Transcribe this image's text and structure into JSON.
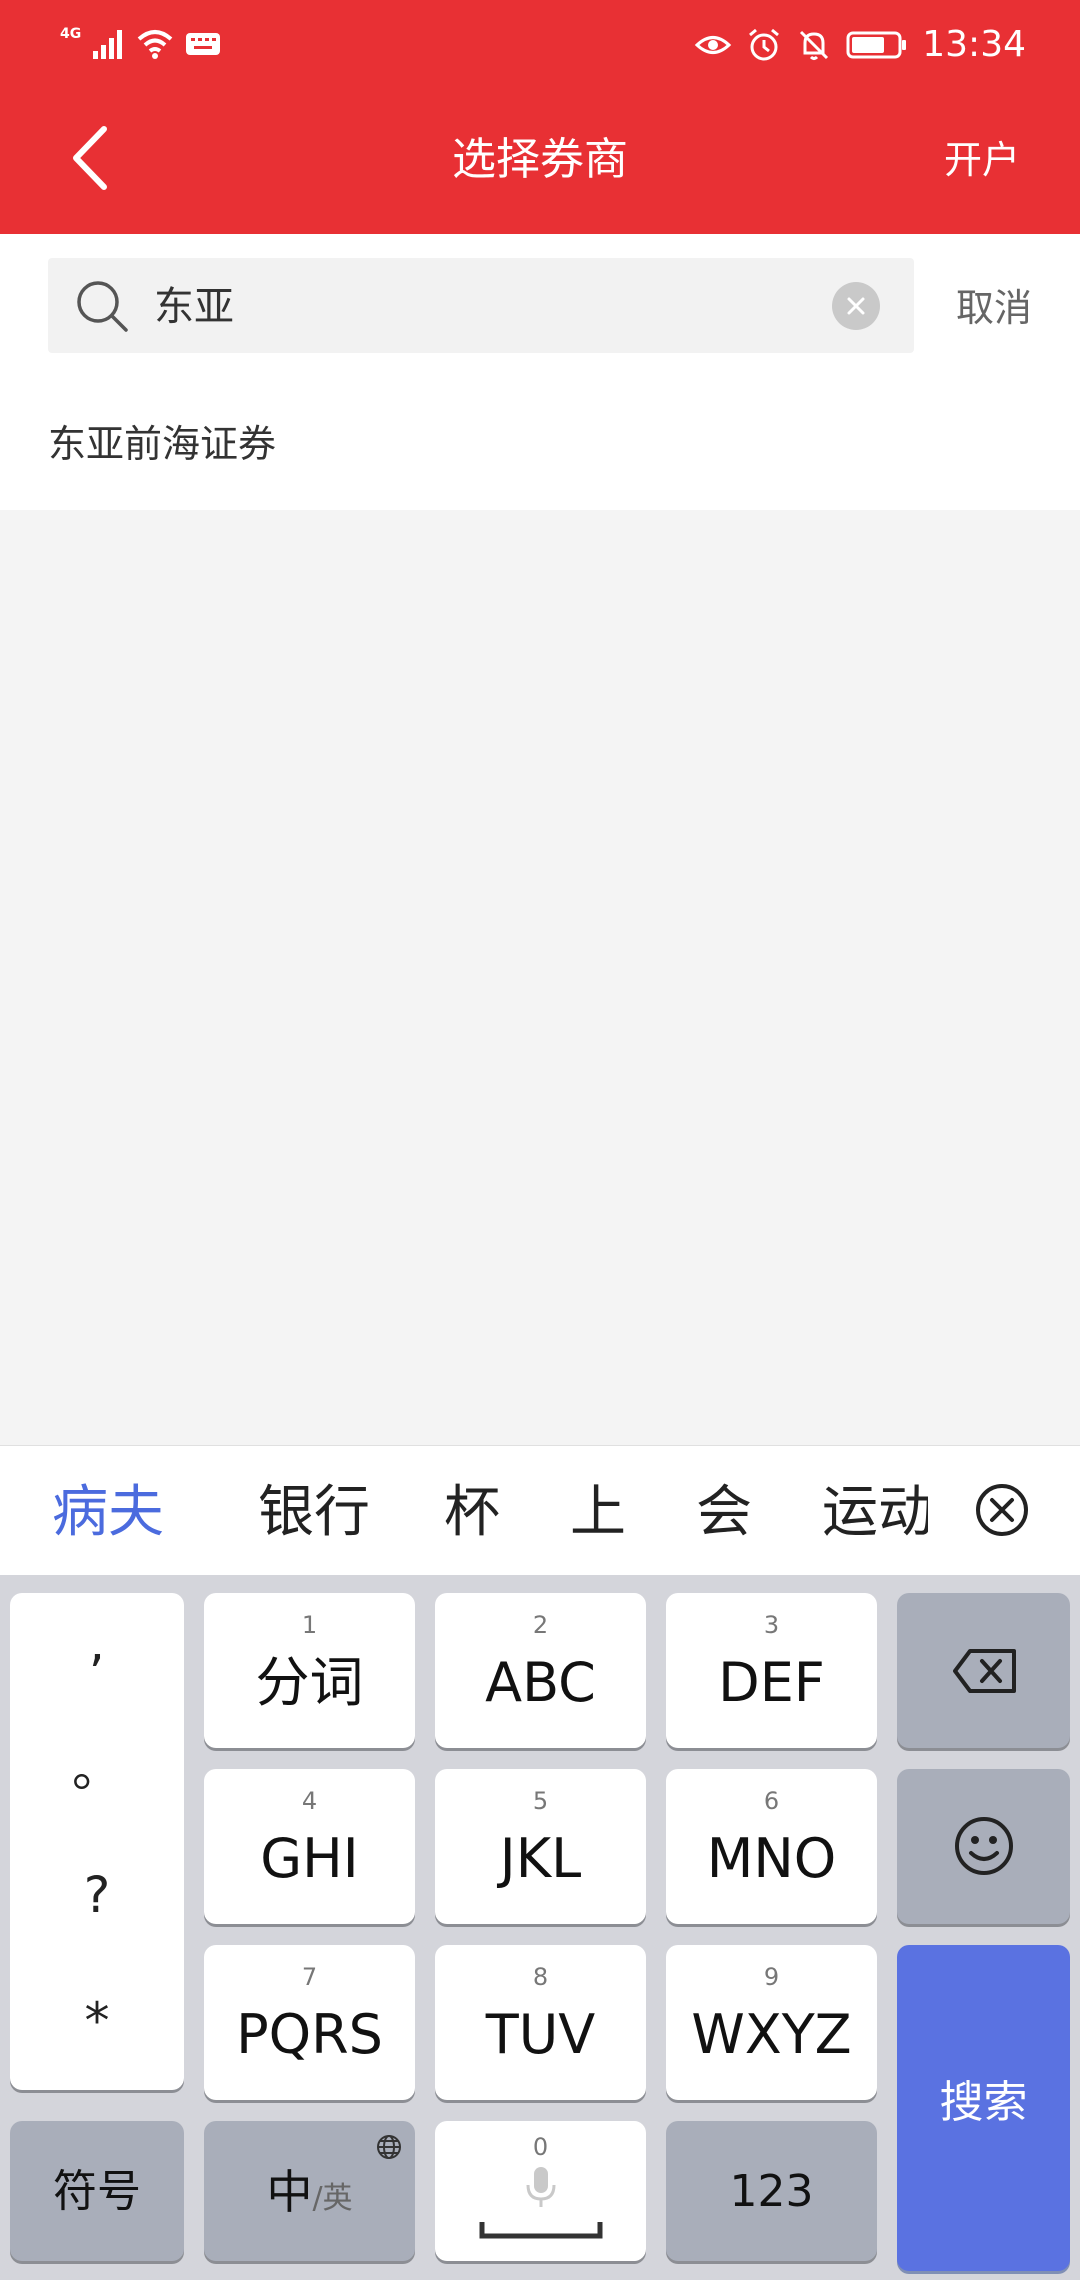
{
  "status_bar": {
    "network": "4G",
    "time": "13:34"
  },
  "header": {
    "title": "选择券商",
    "right_action": "开户"
  },
  "search": {
    "value": "东亚",
    "cancel_label": "取消"
  },
  "results": [
    {
      "label": "东亚前海证券"
    }
  ],
  "candidates": [
    "病夫",
    "银行",
    "杯",
    "上",
    "会",
    "运动"
  ],
  "keyboard": {
    "punctuation": [
      ",",
      "。",
      "?",
      "*"
    ],
    "keys": [
      {
        "num": "1",
        "label": "分词"
      },
      {
        "num": "2",
        "label": "ABC"
      },
      {
        "num": "3",
        "label": "DEF"
      },
      {
        "num": "4",
        "label": "GHI"
      },
      {
        "num": "5",
        "label": "JKL"
      },
      {
        "num": "6",
        "label": "MNO"
      },
      {
        "num": "7",
        "label": "PQRS"
      },
      {
        "num": "8",
        "label": "TUV"
      },
      {
        "num": "9",
        "label": "WXYZ"
      }
    ],
    "symbol_label": "符号",
    "lang_main": "中",
    "lang_sub": "/英",
    "space_num": "0",
    "numeric_label": "123",
    "search_label": "搜索"
  },
  "colors": {
    "header_red": "#e83034",
    "keyboard_blue": "#5a72e1",
    "candidate_blue": "#4b6bde"
  },
  "icons": [
    "back-arrow-icon",
    "search-icon",
    "clear-icon",
    "close-circle-icon",
    "backspace-icon",
    "emoji-icon",
    "microphone-icon",
    "globe-icon",
    "eye-icon",
    "alarm-icon",
    "mute-bell-icon",
    "battery-icon",
    "wifi-icon",
    "signal-icon",
    "keyboard-status-icon"
  ]
}
